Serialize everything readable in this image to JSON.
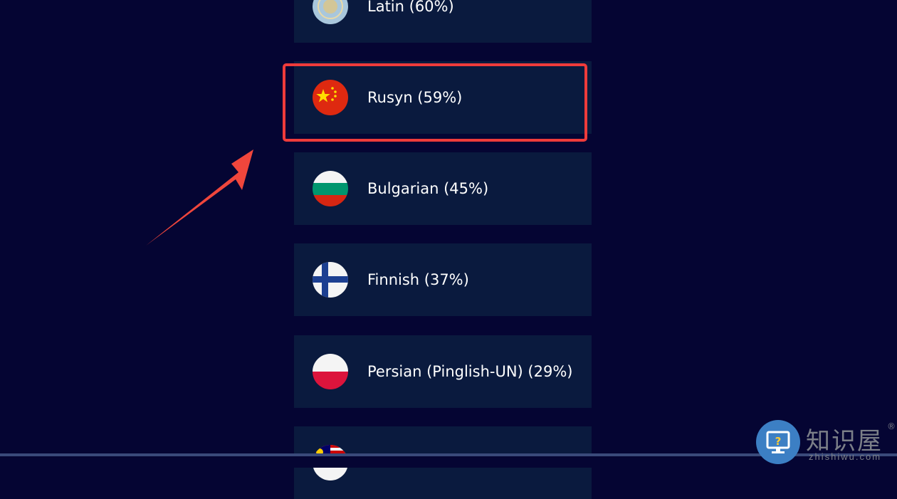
{
  "languages": [
    {
      "label": "Latin (60%)",
      "flag": "latin-flag-icon"
    },
    {
      "label": "Rusyn (59%)",
      "flag": "china-flag-icon"
    },
    {
      "label": "Bulgarian (45%)",
      "flag": "bulgaria-flag-icon"
    },
    {
      "label": "Finnish (37%)",
      "flag": "finland-flag-icon"
    },
    {
      "label": "Persian (Pinglish-UN) (29%)",
      "flag": "poland-flag-icon"
    },
    {
      "label": "",
      "flag": "malaysia-flag-icon"
    }
  ],
  "highlighted_item": "Rusyn (59%)",
  "colors": {
    "background": "#050533",
    "card": "#0a1a3e",
    "highlight": "#ef3b3b",
    "text": "#ffffff"
  },
  "watermark": {
    "brand": "知识屋",
    "registered": "®",
    "domain": "zhishiwu.com"
  }
}
